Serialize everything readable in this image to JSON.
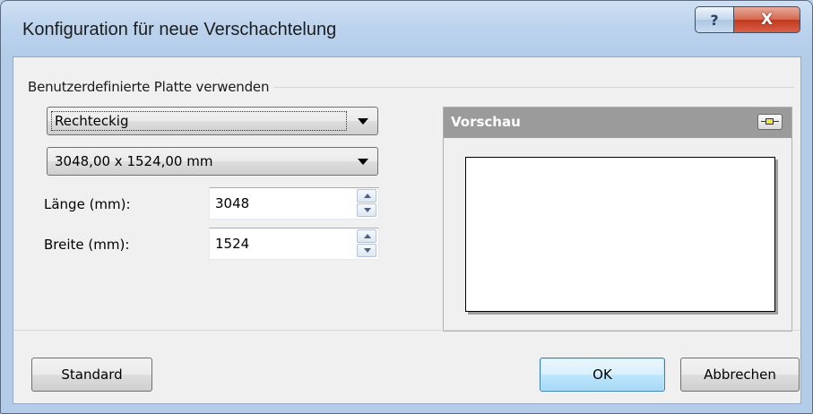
{
  "window": {
    "title": "Konfiguration für neue Verschachtelung",
    "help_glyph": "?",
    "close_glyph": "X"
  },
  "group": {
    "label": "Benutzerdefinierte Platte verwenden",
    "shape_select": {
      "selected": "Rechteckig"
    },
    "size_select": {
      "selected": "3048,00 x 1524,00 mm"
    },
    "length": {
      "label": "Länge (mm):",
      "value": "3048"
    },
    "width": {
      "label": "Breite (mm):",
      "value": "1524"
    }
  },
  "preview": {
    "title": "Vorschau",
    "pin_icon": "pin-icon"
  },
  "buttons": {
    "standard": "Standard",
    "ok": "OK",
    "cancel": "Abbrechen"
  },
  "colors": {
    "preview_header": "#9b9b9b",
    "client_bg": "#f0f0f0",
    "default_button_border": "#3c7fb1"
  }
}
